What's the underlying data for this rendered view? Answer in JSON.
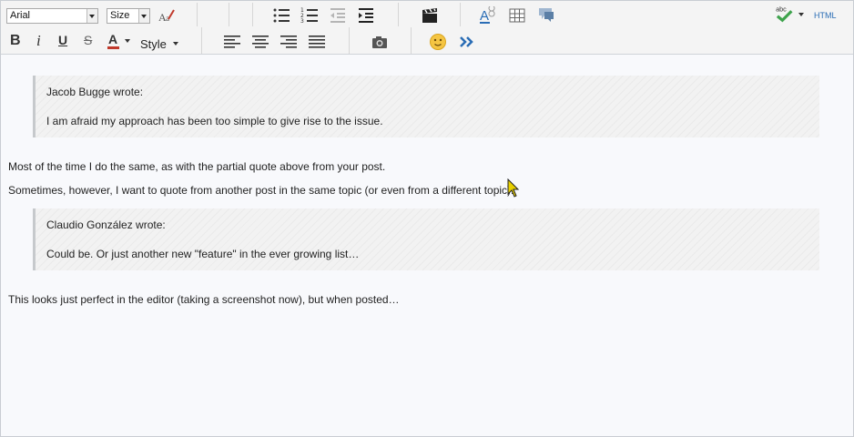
{
  "toolbar": {
    "font_select": "Arial",
    "size_select": "Size",
    "style_label": "Style",
    "html_label": "HTML",
    "bold_label": "B",
    "italic_label": "i",
    "underline_label": "U",
    "strike_label": "S",
    "font_color_label": "A"
  },
  "colors": {
    "font_color_bar": "#c0392b",
    "blue_icon": "#2a6db5",
    "spell_green": "#3fa34d"
  },
  "content": {
    "quote1": {
      "author": "Jacob Bugge wrote:",
      "text": "I am afraid my approach has been too simple to give rise to the issue."
    },
    "para1": "Most of the time I do the same, as with the partial quote above from your post.",
    "para2": "Sometimes, however, I want to quote from another post in the same topic (or even from a different topic):",
    "quote2": {
      "author": "Claudio González wrote:",
      "text": "Could be. Or just another new \"feature\" in the ever growing list…"
    },
    "para3": "This looks just perfect in the editor (taking a screenshot now), but when posted…"
  }
}
